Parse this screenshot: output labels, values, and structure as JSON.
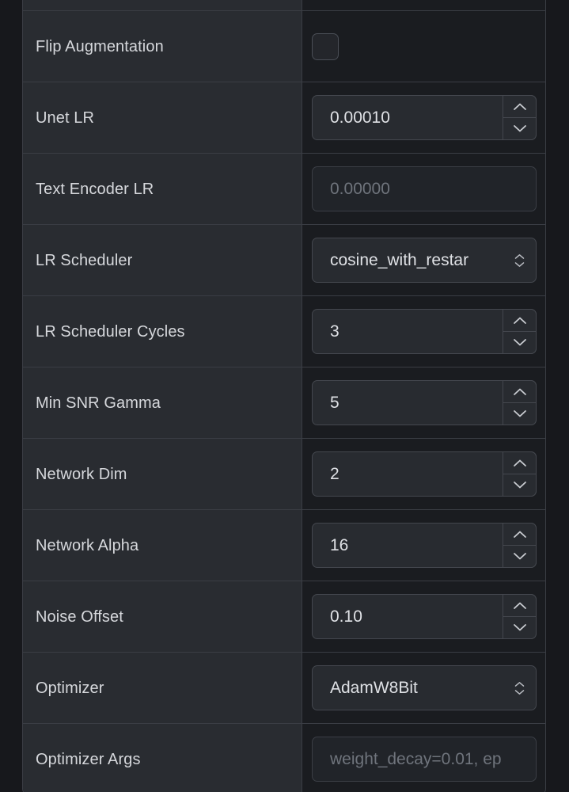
{
  "panel": {
    "name": "training-settings-table",
    "colors": {
      "page_bg": "#17181c",
      "label_cell_bg": "#292c31",
      "control_cell_bg": "#1a1c20",
      "border": "#3a3d44",
      "field_bg": "#282b30",
      "label_text": "#d6d8dc",
      "value_text": "#dfe1e5",
      "placeholder_text": "#6f747c"
    }
  },
  "rows": [
    {
      "label": "",
      "control": "none",
      "partial": true
    },
    {
      "label": "Flip Augmentation",
      "control": "checkbox",
      "checked": false
    },
    {
      "label": "Unet LR",
      "control": "number",
      "value": "0.00010",
      "placeholder": "",
      "spinner": true
    },
    {
      "label": "Text Encoder LR",
      "control": "text",
      "value": "",
      "placeholder": "0.00000",
      "spinner": false
    },
    {
      "label": "LR Scheduler",
      "control": "select",
      "value": "cosine_with_restar"
    },
    {
      "label": "LR Scheduler Cycles",
      "control": "number",
      "value": "3",
      "placeholder": "",
      "spinner": true
    },
    {
      "label": "Min SNR Gamma",
      "control": "number",
      "value": "5",
      "placeholder": "",
      "spinner": true
    },
    {
      "label": "Network Dim",
      "control": "number",
      "value": "2",
      "placeholder": "",
      "spinner": true
    },
    {
      "label": "Network Alpha",
      "control": "number",
      "value": "16",
      "placeholder": "",
      "spinner": true
    },
    {
      "label": "Noise Offset",
      "control": "number",
      "value": "0.10",
      "placeholder": "",
      "spinner": true
    },
    {
      "label": "Optimizer",
      "control": "select",
      "value": "AdamW8Bit"
    },
    {
      "label": "Optimizer Args",
      "control": "text",
      "value": "",
      "placeholder": "weight_decay=0.01, ep",
      "spinner": false
    }
  ],
  "icons": {
    "spinner_up": "chevron-up-icon",
    "spinner_down": "chevron-down-icon",
    "select_indicator": "select-updown-icon"
  }
}
